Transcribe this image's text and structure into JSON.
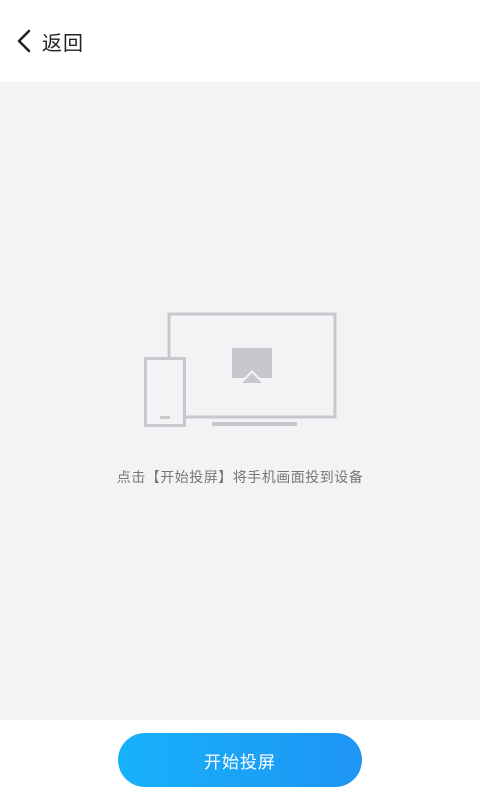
{
  "header": {
    "back_label": "返回",
    "back_icon": "chevron-left-icon"
  },
  "main": {
    "illustration": "phone-to-tv-cast-illustration",
    "hint": "点击【开始投屏】将手机画面投到设备"
  },
  "footer": {
    "start_button_label": "开始投屏"
  },
  "colors": {
    "background": "#f2f3f5",
    "accent": "#1ea3f8",
    "icon_stroke": "#c6c8cc"
  }
}
